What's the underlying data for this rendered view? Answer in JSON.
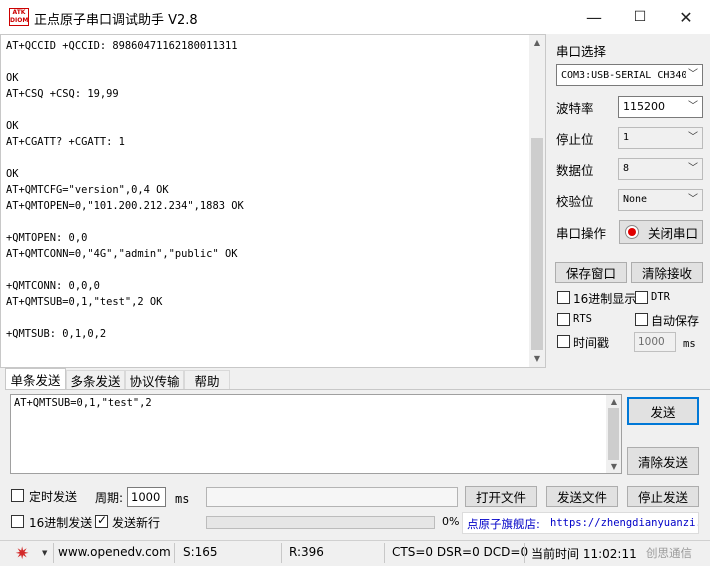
{
  "window": {
    "logo_text": "ATK DIOM",
    "title": "正点原子串口调试助手 V2.8",
    "minimize_glyph": "—",
    "maximize_glyph": "☐",
    "close_glyph": "✕"
  },
  "receive": {
    "lines": [
      "AT+QCCID +QCCID: 89860471162180011311",
      "",
      "OK",
      "AT+CSQ +CSQ: 19,99",
      "",
      "OK",
      "AT+CGATT? +CGATT: 1",
      "",
      "OK",
      "AT+QMTCFG=\"version\",0,4 OK",
      "AT+QMTOPEN=0,\"101.200.212.234\",1883 OK",
      "",
      "+QMTOPEN: 0,0",
      "AT+QMTCONN=0,\"4G\",\"admin\",\"public\" OK",
      "",
      "+QMTCONN: 0,0,0",
      "AT+QMTSUB=0,1,\"test\",2 OK",
      "",
      "+QMTSUB: 0,1,0,2"
    ]
  },
  "panel": {
    "port_select_label": "串口选择",
    "port_value": "COM3:USB-SERIAL CH340",
    "baud_label": "波特率",
    "baud_value": "115200",
    "stop_label": "停止位",
    "stop_value": "1",
    "data_label": "数据位",
    "data_value": "8",
    "parity_label": "校验位",
    "parity_value": "None",
    "serial_op_label": "串口操作",
    "close_port_button": "关闭串口",
    "save_window_button": "保存窗口",
    "clear_recv_button": "清除接收",
    "hex_display_label": "16进制显示",
    "dtr_label": "DTR",
    "rts_label": "RTS",
    "auto_save_label": "自动保存",
    "timestamp_label": "时间戳",
    "timestamp_value": "1000",
    "timestamp_unit": "ms",
    "dropdown_glyph": "﹀"
  },
  "tabs": [
    "单条发送",
    "多条发送",
    "协议传输",
    "帮助"
  ],
  "send": {
    "text": "AT+QMTSUB=0,1,\"test\",2",
    "send_button": "发送",
    "clear_send_button": "清除发送",
    "timed_send_label": "定时发送",
    "period_label": "周期:",
    "period_value": "1000",
    "period_unit": "ms",
    "open_file_button": "打开文件",
    "send_file_button": "发送文件",
    "stop_send_button": "停止发送",
    "hex_send_label": "16进制发送",
    "send_newline_label": "发送新行",
    "progress_percent_text": "0%",
    "progress": 0,
    "flagship_label": "点原子旗舰店:",
    "flagship_url": "https://zhengdianyuanzi."
  },
  "statusbar": {
    "website": "www.openedv.com",
    "sent": "S:165",
    "received": "R:396",
    "signals": "CTS=0 DSR=0 DCD=0",
    "current_time": "当前时间 11:02:11",
    "watermark": "创思通信"
  },
  "colors": {
    "gear": "#d32a2a",
    "record_red": "#e00000",
    "flagship_blue": "#0000c8",
    "focus_blue": "#0078d7"
  }
}
